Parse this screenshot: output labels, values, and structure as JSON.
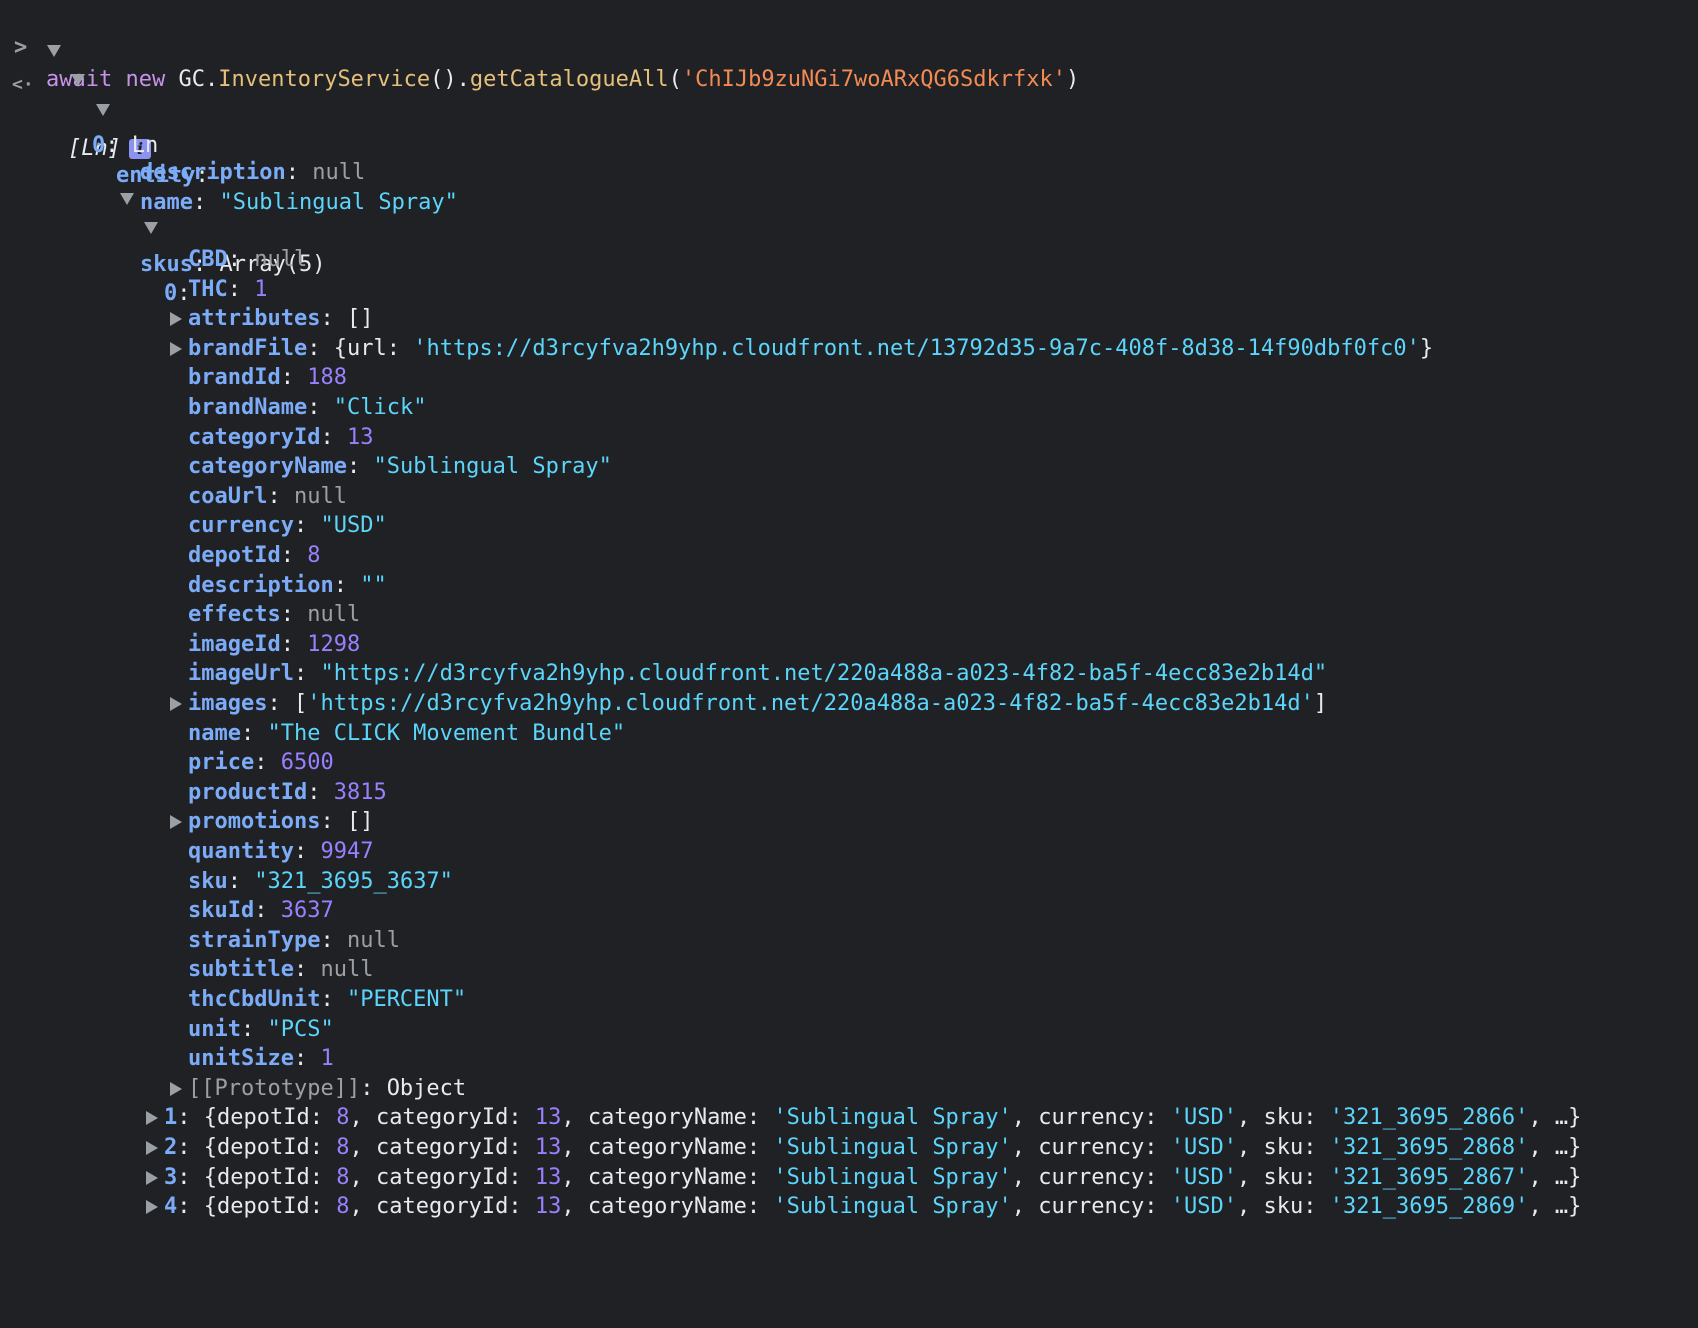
{
  "command": {
    "prompt": ">",
    "await_kw": "await",
    "new_kw": "new",
    "obj": "GC.",
    "cls": "InventoryService",
    "call": "().",
    "method": "getCatalogueAll",
    "open": "(",
    "arg": "'ChIJb9zuNGi7woARxQG6Sdkrfxk'",
    "close": ")"
  },
  "result": {
    "return_icon": "<·",
    "summary": "[Ln]",
    "info_badge": "i",
    "item0_key": "0",
    "item0_type": "Ln",
    "entity_key": "entity",
    "entity_description_key": "description",
    "entity_description_value": "null",
    "entity_name_key": "name",
    "entity_name_value": "\"Sublingual Spray\"",
    "skus_key": "skus",
    "skus_value": "Array(5)",
    "sku0_key": "0"
  },
  "sku0_props": [
    {
      "key": "CBD",
      "value": "null",
      "kind": "nul",
      "expandable": false
    },
    {
      "key": "THC",
      "value": "1",
      "kind": "num",
      "expandable": false
    },
    {
      "key": "attributes",
      "value": "[]",
      "kind": "plain",
      "expandable": true
    },
    {
      "key": "brandFile",
      "value": "",
      "kind": "brandfile",
      "expandable": true
    },
    {
      "key": "brandId",
      "value": "188",
      "kind": "num",
      "expandable": false
    },
    {
      "key": "brandName",
      "value": "\"Click\"",
      "kind": "str",
      "expandable": false
    },
    {
      "key": "categoryId",
      "value": "13",
      "kind": "num",
      "expandable": false
    },
    {
      "key": "categoryName",
      "value": "\"Sublingual Spray\"",
      "kind": "str",
      "expandable": false
    },
    {
      "key": "coaUrl",
      "value": "null",
      "kind": "nul",
      "expandable": false
    },
    {
      "key": "currency",
      "value": "\"USD\"",
      "kind": "str",
      "expandable": false
    },
    {
      "key": "depotId",
      "value": "8",
      "kind": "num",
      "expandable": false
    },
    {
      "key": "description",
      "value": "\"\"",
      "kind": "str",
      "expandable": false
    },
    {
      "key": "effects",
      "value": "null",
      "kind": "nul",
      "expandable": false
    },
    {
      "key": "imageId",
      "value": "1298",
      "kind": "num",
      "expandable": false
    },
    {
      "key": "imageUrl",
      "value": "\"https://d3rcyfva2h9yhp.cloudfront.net/220a488a-a023-4f82-ba5f-4ecc83e2b14d\"",
      "kind": "str",
      "expandable": false
    },
    {
      "key": "images",
      "value": "",
      "kind": "images",
      "expandable": true
    },
    {
      "key": "name",
      "value": "\"The CLICK Movement Bundle\"",
      "kind": "str",
      "expandable": false
    },
    {
      "key": "price",
      "value": "6500",
      "kind": "num",
      "expandable": false
    },
    {
      "key": "productId",
      "value": "3815",
      "kind": "num",
      "expandable": false
    },
    {
      "key": "promotions",
      "value": "[]",
      "kind": "plain",
      "expandable": true
    },
    {
      "key": "quantity",
      "value": "9947",
      "kind": "num",
      "expandable": false
    },
    {
      "key": "sku",
      "value": "\"321_3695_3637\"",
      "kind": "str",
      "expandable": false
    },
    {
      "key": "skuId",
      "value": "3637",
      "kind": "num",
      "expandable": false
    },
    {
      "key": "strainType",
      "value": "null",
      "kind": "nul",
      "expandable": false
    },
    {
      "key": "subtitle",
      "value": "null",
      "kind": "nul",
      "expandable": false
    },
    {
      "key": "thcCbdUnit",
      "value": "\"PERCENT\"",
      "kind": "str",
      "expandable": false
    },
    {
      "key": "unit",
      "value": "\"PCS\"",
      "kind": "str",
      "expandable": false
    },
    {
      "key": "unitSize",
      "value": "1",
      "kind": "num",
      "expandable": false
    },
    {
      "key": "[[Prototype]]",
      "value": "Object",
      "kind": "proto",
      "expandable": true
    }
  ],
  "brandFile_preview": {
    "url_key": "url",
    "url_value": "'https://d3rcyfva2h9yhp.cloudfront.net/13792d35-9a7c-408f-8d38-14f90dbf0fc0'"
  },
  "images_preview": {
    "value": "'https://d3rcyfva2h9yhp.cloudfront.net/220a488a-a023-4f82-ba5f-4ecc83e2b14d'"
  },
  "collapsed_skus": [
    {
      "index": "1",
      "depotId": "8",
      "categoryId": "13",
      "categoryName": "'Sublingual Spray'",
      "currency": "'USD'",
      "sku": "'321_3695_2866'"
    },
    {
      "index": "2",
      "depotId": "8",
      "categoryId": "13",
      "categoryName": "'Sublingual Spray'",
      "currency": "'USD'",
      "sku": "'321_3695_2868'"
    },
    {
      "index": "3",
      "depotId": "8",
      "categoryId": "13",
      "categoryName": "'Sublingual Spray'",
      "currency": "'USD'",
      "sku": "'321_3695_2867'"
    },
    {
      "index": "4",
      "depotId": "8",
      "categoryId": "13",
      "categoryName": "'Sublingual Spray'",
      "currency": "'USD'",
      "sku": "'321_3695_2869'"
    }
  ],
  "colors": {
    "background": "#202124",
    "key": "#7cacf8",
    "string": "#5cd5fb",
    "number": "#9980ff",
    "null": "#9aa0a6",
    "command_string": "#f28b54",
    "method": "#e5c07b",
    "keyword": "#c792ea"
  }
}
